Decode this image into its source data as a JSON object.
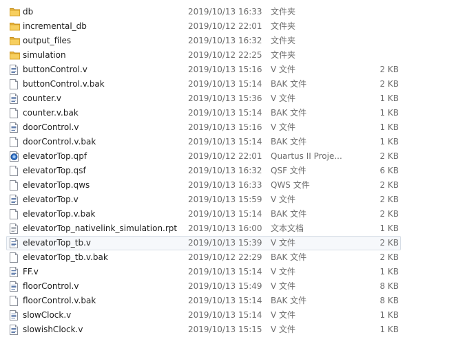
{
  "files": [
    {
      "name": "db",
      "date": "2019/10/13 16:33",
      "type": "文件夹",
      "size": "",
      "icon": "folder-icon"
    },
    {
      "name": "incremental_db",
      "date": "2019/10/12 22:01",
      "type": "文件夹",
      "size": "",
      "icon": "folder-icon"
    },
    {
      "name": "output_files",
      "date": "2019/10/13 16:32",
      "type": "文件夹",
      "size": "",
      "icon": "folder-icon"
    },
    {
      "name": "simulation",
      "date": "2019/10/12 22:25",
      "type": "文件夹",
      "size": "",
      "icon": "folder-icon"
    },
    {
      "name": "buttonControl.v",
      "date": "2019/10/13 15:16",
      "type": "V 文件",
      "size": "2 KB",
      "icon": "text-file-icon"
    },
    {
      "name": "buttonControl.v.bak",
      "date": "2019/10/13 15:14",
      "type": "BAK 文件",
      "size": "2 KB",
      "icon": "blank-file-icon"
    },
    {
      "name": "counter.v",
      "date": "2019/10/13 15:36",
      "type": "V 文件",
      "size": "1 KB",
      "icon": "text-file-icon"
    },
    {
      "name": "counter.v.bak",
      "date": "2019/10/13 15:14",
      "type": "BAK 文件",
      "size": "1 KB",
      "icon": "blank-file-icon"
    },
    {
      "name": "doorControl.v",
      "date": "2019/10/13 15:16",
      "type": "V 文件",
      "size": "1 KB",
      "icon": "text-file-icon"
    },
    {
      "name": "doorControl.v.bak",
      "date": "2019/10/13 15:14",
      "type": "BAK 文件",
      "size": "1 KB",
      "icon": "blank-file-icon"
    },
    {
      "name": "elevatorTop.qpf",
      "date": "2019/10/12 22:01",
      "type": "Quartus II Proje...",
      "size": "2 KB",
      "icon": "quartus-project-icon"
    },
    {
      "name": "elevatorTop.qsf",
      "date": "2019/10/13 16:32",
      "type": "QSF 文件",
      "size": "6 KB",
      "icon": "blank-file-icon"
    },
    {
      "name": "elevatorTop.qws",
      "date": "2019/10/13 16:33",
      "type": "QWS 文件",
      "size": "2 KB",
      "icon": "blank-file-icon"
    },
    {
      "name": "elevatorTop.v",
      "date": "2019/10/13 15:59",
      "type": "V 文件",
      "size": "2 KB",
      "icon": "text-file-icon"
    },
    {
      "name": "elevatorTop.v.bak",
      "date": "2019/10/13 15:14",
      "type": "BAK 文件",
      "size": "2 KB",
      "icon": "blank-file-icon"
    },
    {
      "name": "elevatorTop_nativelink_simulation.rpt",
      "date": "2019/10/13 16:00",
      "type": "文本文档",
      "size": "1 KB",
      "icon": "text-document-icon"
    },
    {
      "name": "elevatorTop_tb.v",
      "date": "2019/10/13 15:39",
      "type": "V 文件",
      "size": "2 KB",
      "icon": "text-file-icon",
      "selected": true
    },
    {
      "name": "elevatorTop_tb.v.bak",
      "date": "2019/10/12 22:29",
      "type": "BAK 文件",
      "size": "2 KB",
      "icon": "blank-file-icon"
    },
    {
      "name": "FF.v",
      "date": "2019/10/13 15:14",
      "type": "V 文件",
      "size": "1 KB",
      "icon": "text-file-icon"
    },
    {
      "name": "floorControl.v",
      "date": "2019/10/13 15:49",
      "type": "V 文件",
      "size": "8 KB",
      "icon": "text-file-icon"
    },
    {
      "name": "floorControl.v.bak",
      "date": "2019/10/13 15:14",
      "type": "BAK 文件",
      "size": "8 KB",
      "icon": "blank-file-icon"
    },
    {
      "name": "slowClock.v",
      "date": "2019/10/13 15:14",
      "type": "V 文件",
      "size": "1 KB",
      "icon": "text-file-icon"
    },
    {
      "name": "slowishClock.v",
      "date": "2019/10/13 15:15",
      "type": "V 文件",
      "size": "1 KB",
      "icon": "text-file-icon"
    }
  ]
}
